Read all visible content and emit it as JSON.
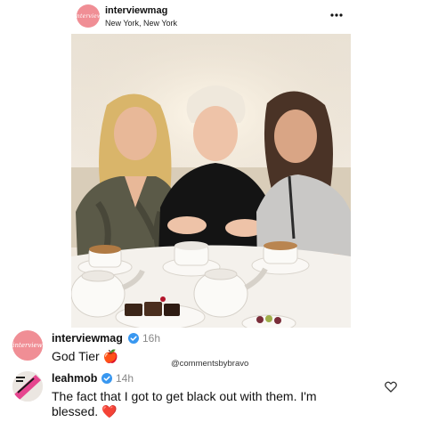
{
  "post": {
    "avatar_text": "interview",
    "username": "interviewmag",
    "location": "New York, New York",
    "more_icon": "more-horizontal-icon"
  },
  "watermark": "@commentsbybravo",
  "comments": [
    {
      "username": "interviewmag",
      "verified": true,
      "time": "16h",
      "text": "God Tier 🍎",
      "avatar_text": "interview",
      "avatar_color": "#f08e95"
    },
    {
      "username": "leahmob",
      "verified": true,
      "time": "14h",
      "text_line1": "The fact that I got to get black out with them. I'm",
      "text_line2": "blessed. ❤️",
      "like_icon": "heart-outline-icon"
    }
  ],
  "colors": {
    "verified_blue": "#3897f0",
    "timestamp_gray": "#888888",
    "brand_pink": "#f08e95"
  }
}
